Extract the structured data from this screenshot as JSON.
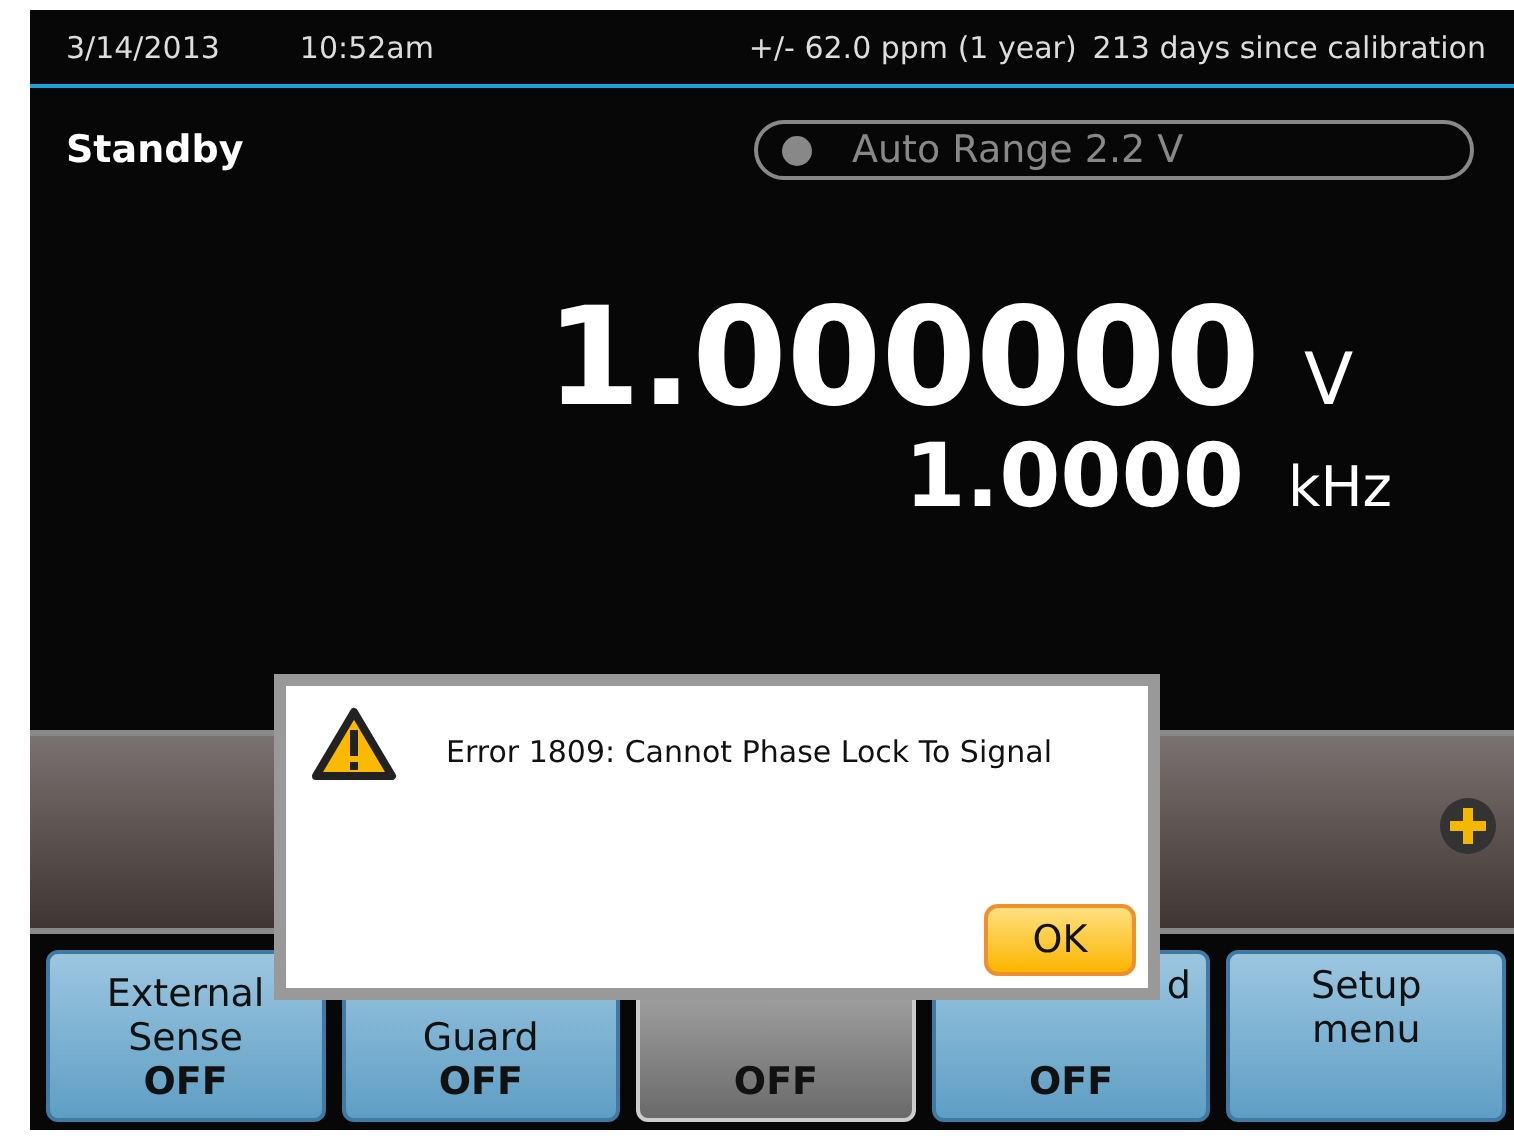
{
  "status_bar": {
    "date": "3/14/2013",
    "time": "10:52am",
    "accuracy": "+/- 62.0 ppm (1 year)",
    "calibration": "213 days since calibration"
  },
  "mode": "Standby",
  "range": {
    "label": "Auto Range 2.2 V",
    "on": false
  },
  "reading": {
    "value": "1.000000",
    "unit": "V",
    "frequency": "1.0000",
    "frequency_unit": "kHz"
  },
  "softkeys": [
    {
      "label": "External Sense",
      "state": "OFF",
      "selected": false,
      "kind": "full"
    },
    {
      "label": "Guard",
      "state": "OFF",
      "selected": false,
      "kind": "full"
    },
    {
      "state": "OFF",
      "selected": true,
      "kind": "full"
    },
    {
      "label": "d",
      "state": "OFF",
      "selected": false,
      "kind": "partial"
    },
    {
      "label": "Setup menu",
      "selected": false,
      "kind": "full"
    }
  ],
  "dialog": {
    "message": "Error 1809: Cannot Phase Lock To Signal",
    "button": "OK"
  }
}
